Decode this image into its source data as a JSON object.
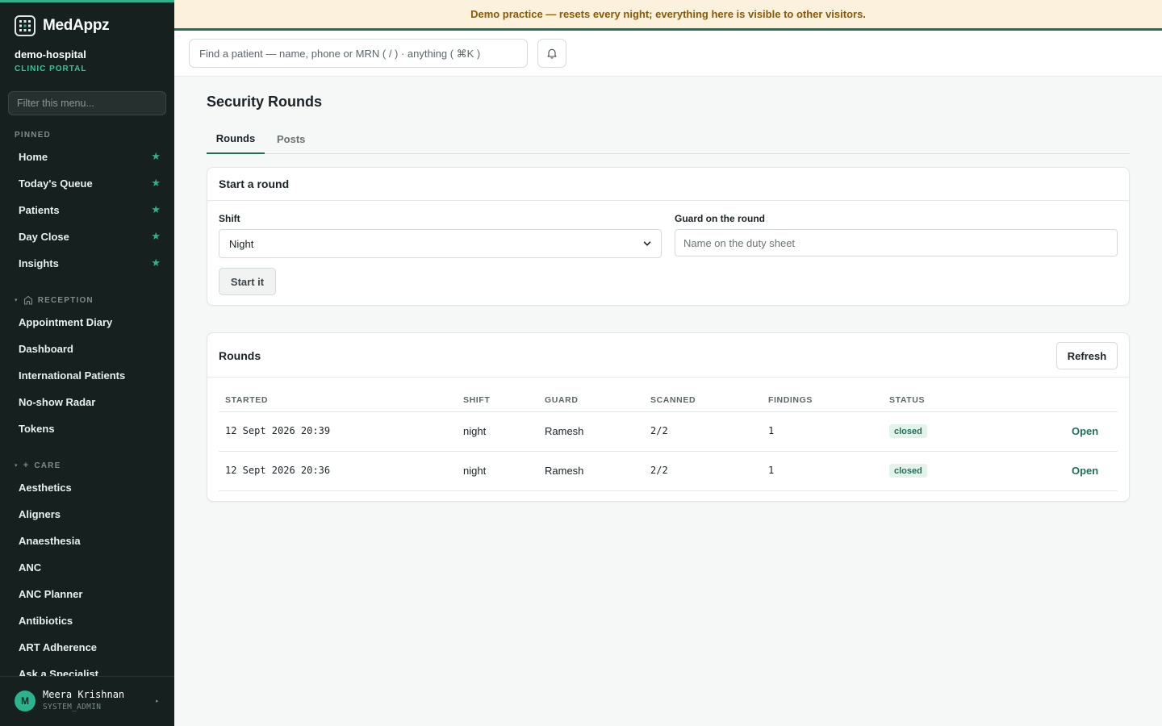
{
  "app": {
    "brand": "MedAppz"
  },
  "org": {
    "name": "demo-hospital",
    "subtitle": "CLINIC PORTAL"
  },
  "sidebar": {
    "filter_placeholder": "Filter this menu...",
    "pinned_label": "PINNED",
    "pinned": [
      {
        "label": "Home",
        "icon": "star-icon"
      },
      {
        "label": "Today's Queue",
        "icon": "star-icon"
      },
      {
        "label": "Patients",
        "icon": "star-icon"
      },
      {
        "label": "Day Close",
        "icon": "star-icon"
      },
      {
        "label": "Insights",
        "icon": "star-icon"
      }
    ],
    "reception_label": "RECEPTION",
    "reception": [
      {
        "label": "Appointment Diary"
      },
      {
        "label": "Dashboard"
      },
      {
        "label": "International Patients"
      },
      {
        "label": "No-show Radar"
      },
      {
        "label": "Tokens"
      }
    ],
    "care_label": "CARE",
    "care": [
      {
        "label": "Aesthetics"
      },
      {
        "label": "Aligners"
      },
      {
        "label": "Anaesthesia"
      },
      {
        "label": "ANC"
      },
      {
        "label": "ANC Planner"
      },
      {
        "label": "Antibiotics"
      },
      {
        "label": "ART Adherence"
      },
      {
        "label": "Ask a Specialist"
      }
    ]
  },
  "user": {
    "initial": "M",
    "name": "Meera Krishnan",
    "role": "SYSTEM_ADMIN"
  },
  "banner": {
    "text": "Demo practice — resets every night; everything here is visible to other visitors."
  },
  "header": {
    "search_placeholder": "Find a patient — name, phone or MRN ( / ) · anything ( ⌘K )"
  },
  "page": {
    "title": "Security Rounds",
    "tabs": [
      {
        "label": "Rounds"
      },
      {
        "label": "Posts"
      }
    ]
  },
  "start_round": {
    "title": "Start a round",
    "shift_label": "Shift",
    "shift_value": "Night",
    "guard_label": "Guard on the round",
    "guard_placeholder": "Name on the duty sheet",
    "submit_label": "Start it"
  },
  "rounds": {
    "title": "Rounds",
    "refresh_label": "Refresh",
    "columns": [
      "STARTED",
      "SHIFT",
      "GUARD",
      "SCANNED",
      "FINDINGS",
      "STATUS"
    ],
    "rows": [
      {
        "started": "12 Sept 2026 20:39",
        "shift": "night",
        "guard": "Ramesh",
        "scanned": "2/2",
        "findings": "1",
        "status": "closed",
        "action": "Open"
      },
      {
        "started": "12 Sept 2026 20:36",
        "shift": "night",
        "guard": "Ramesh",
        "scanned": "2/2",
        "findings": "1",
        "status": "closed",
        "action": "Open"
      }
    ]
  },
  "colors": {
    "accent": "#1f6f5a",
    "sidebar_bg": "#15201f",
    "star": "#2bb38e",
    "banner_bg": "#fbf1dc",
    "banner_text": "#8a5a00"
  }
}
